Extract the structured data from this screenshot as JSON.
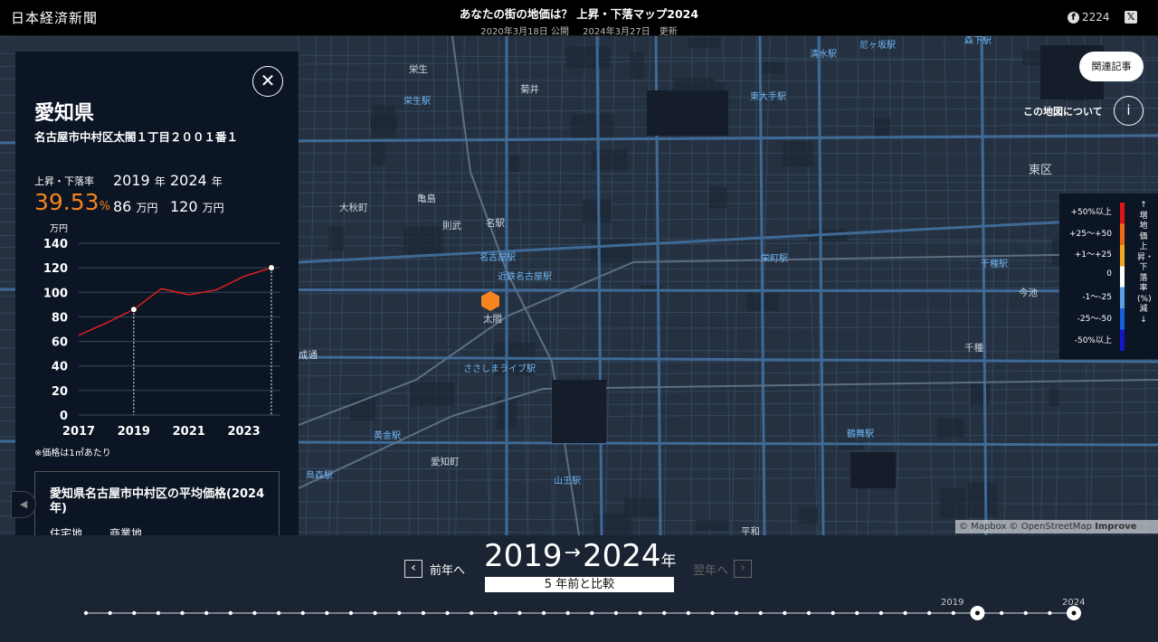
{
  "header": {
    "logo": "日本経済新聞",
    "title": "あなたの街の地価は？ 上昇・下落マップ2024",
    "published": "2020年3月18日 公開",
    "updated": "2024年3月27日　更新",
    "facebook_count": "2224",
    "facebook_icon": "facebook-icon",
    "x_icon": "x-share-icon"
  },
  "panel": {
    "close_label": "✕",
    "prefecture": "愛知県",
    "address": "名古屋市中村区太閤１丁目２００１番１",
    "change_label": "上昇・下落率",
    "change_value": "39.53",
    "change_unit": "%",
    "year_from": "2019",
    "year_to": "2024",
    "year_unit": "年",
    "price_from": "86",
    "price_to": "120",
    "price_unit": "万円",
    "note": "※価格は1㎡あたり",
    "avg_title": "愛知県名古屋市中村区の平均価格(2024年)",
    "avg_col1": "住宅地",
    "avg_col2": "商業地"
  },
  "chart_data": {
    "type": "line",
    "ylabel": "万円",
    "ylim": [
      0,
      140
    ],
    "yticks": [
      0,
      20,
      40,
      60,
      80,
      100,
      120,
      140
    ],
    "xticks": [
      2017,
      2019,
      2021,
      2023
    ],
    "x": [
      2017,
      2018,
      2019,
      2020,
      2021,
      2022,
      2023,
      2024
    ],
    "values": [
      65,
      75,
      86,
      103,
      98,
      102,
      113,
      120
    ],
    "highlight_years": [
      2019,
      2024
    ],
    "line_color": "#e01f1f",
    "grid": true
  },
  "map": {
    "labels": [
      {
        "text": "栄生",
        "kind": "area"
      },
      {
        "text": "菊井",
        "kind": "area"
      },
      {
        "text": "大秋町",
        "kind": "area"
      },
      {
        "text": "亀島",
        "kind": "area"
      },
      {
        "text": "則武",
        "kind": "area"
      },
      {
        "text": "名駅",
        "kind": "area"
      },
      {
        "text": "太閤",
        "kind": "area"
      },
      {
        "text": "成通",
        "kind": "area"
      },
      {
        "text": "愛知町",
        "kind": "area"
      },
      {
        "text": "東区",
        "kind": "area"
      },
      {
        "text": "今池",
        "kind": "area"
      },
      {
        "text": "千種",
        "kind": "area"
      },
      {
        "text": "平和",
        "kind": "area"
      },
      {
        "text": "栄生駅",
        "kind": "station"
      },
      {
        "text": "清水駅",
        "kind": "station"
      },
      {
        "text": "尼ヶ坂駅",
        "kind": "station"
      },
      {
        "text": "森下駅",
        "kind": "station"
      },
      {
        "text": "東大手駅",
        "kind": "station"
      },
      {
        "text": "名古屋駅",
        "kind": "station"
      },
      {
        "text": "近鉄名古屋駅",
        "kind": "station"
      },
      {
        "text": "栄町駅",
        "kind": "station"
      },
      {
        "text": "千種駅",
        "kind": "station"
      },
      {
        "text": "ささしまライブ駅",
        "kind": "station"
      },
      {
        "text": "黄金駅",
        "kind": "station"
      },
      {
        "text": "鶴舞駅",
        "kind": "station"
      },
      {
        "text": "山王駅",
        "kind": "station"
      },
      {
        "text": "烏森駅",
        "kind": "station"
      }
    ],
    "marker_color": "#f5841f",
    "related_button": "関連記事",
    "about_label": "この地図について",
    "info_label": "i",
    "credit_text": "© Mapbox © OpenStreetMap",
    "credit_link": "Improve this map"
  },
  "legend": {
    "rows": [
      "+50%以上",
      "+25〜+50",
      "+1〜+25",
      "0",
      "-1〜-25",
      "-25〜-50",
      "-50%以上"
    ],
    "colors": [
      "#e01515",
      "#f06a12",
      "#f5a623",
      "#ffffff",
      "#5aa0e6",
      "#1a5fe0",
      "#1515c8"
    ],
    "vertical_text": "↑増　地価上昇・下落率(%)　減↓"
  },
  "footer": {
    "prev_label": "前年へ",
    "next_label": "翌年へ",
    "year_from": "2019",
    "arrow": "→",
    "year_to": "2024",
    "year_unit": "年",
    "compare_label": "5 年前と比較",
    "timeline_label_1": "2019",
    "timeline_label_2": "2024",
    "timeline_count": 42,
    "timeline_selected": [
      37,
      41
    ]
  }
}
